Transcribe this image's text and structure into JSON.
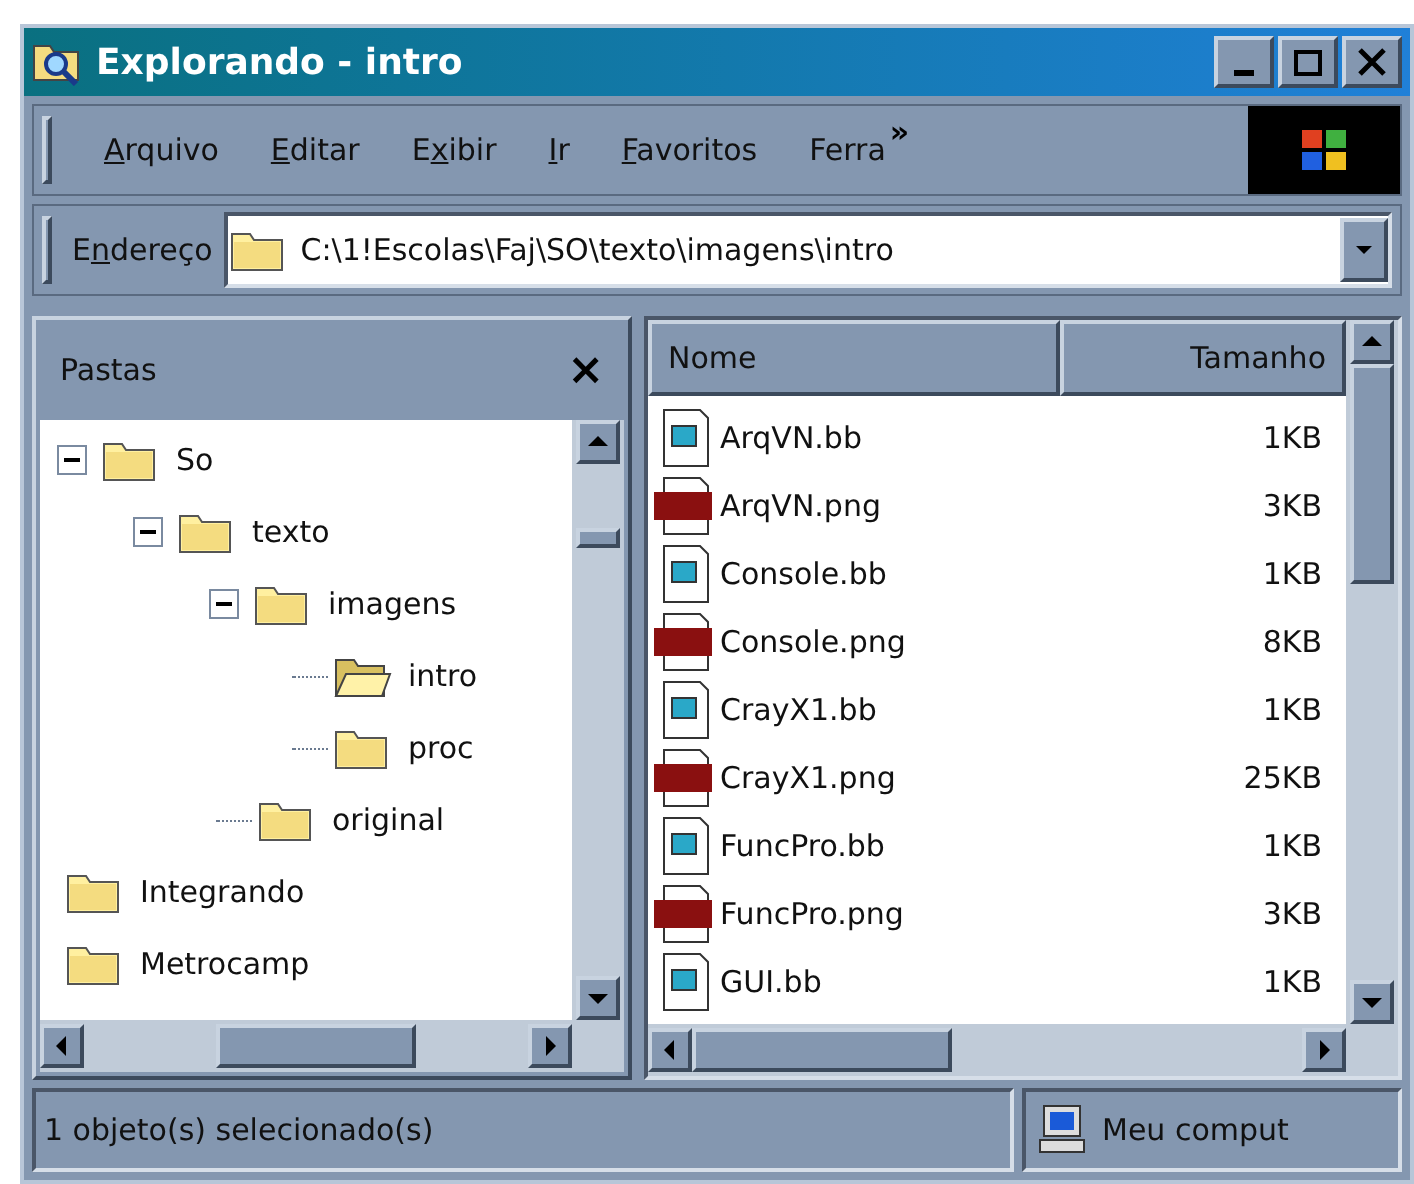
{
  "window": {
    "title": "Explorando - intro"
  },
  "menu": [
    {
      "underlined": "A",
      "after": "rquivo"
    },
    {
      "underlined": "E",
      "after": "ditar"
    },
    {
      "before": "E",
      "underlined": "x",
      "after": "ibir"
    },
    {
      "underlined": "I",
      "after": "r"
    },
    {
      "underlined": "F",
      "after": "avoritos"
    },
    {
      "before": "Ferra"
    }
  ],
  "menu_overflow": "»",
  "address": {
    "label": {
      "before": "E",
      "underlined": "n",
      "after": "dereço"
    },
    "value": "C:\\1!Escolas\\Faj\\SO\\texto\\imagens\\intro"
  },
  "folders_pane": {
    "title": "Pastas",
    "close": "×",
    "tree": [
      {
        "name": "So",
        "open": false,
        "expanded": true,
        "children": [
          {
            "name": "texto",
            "open": false,
            "expanded": true,
            "children": [
              {
                "name": "imagens",
                "open": false,
                "expanded": true,
                "children": [
                  {
                    "name": "intro",
                    "open": true
                  },
                  {
                    "name": "proc",
                    "open": false
                  }
                ]
              },
              {
                "name": "original",
                "open": false
              }
            ]
          }
        ]
      },
      {
        "name": "Integrando",
        "open": false
      },
      {
        "name": "Metrocamp",
        "open": false
      }
    ]
  },
  "files": {
    "columns": [
      "Nome",
      "Tamanho"
    ],
    "rows": [
      {
        "name": "ArqVN.bb",
        "size": "1KB",
        "kind": "bb"
      },
      {
        "name": "ArqVN.png",
        "size": "3KB",
        "kind": "png"
      },
      {
        "name": "Console.bb",
        "size": "1KB",
        "kind": "bb"
      },
      {
        "name": "Console.png",
        "size": "8KB",
        "kind": "png"
      },
      {
        "name": "CrayX1.bb",
        "size": "1KB",
        "kind": "bb"
      },
      {
        "name": "CrayX1.png",
        "size": "25KB",
        "kind": "png"
      },
      {
        "name": "FuncPro.bb",
        "size": "1KB",
        "kind": "bb"
      },
      {
        "name": "FuncPro.png",
        "size": "3KB",
        "kind": "png"
      },
      {
        "name": "GUI.bb",
        "size": "1KB",
        "kind": "bb"
      }
    ]
  },
  "status_bar": {
    "text": "1 objeto(s) selecionado(s)",
    "zone": "Meu comput"
  }
}
